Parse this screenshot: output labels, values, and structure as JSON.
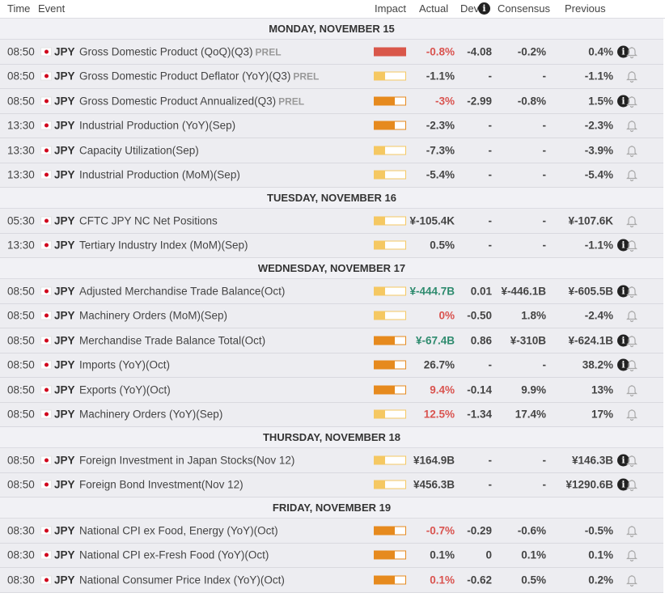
{
  "columns": {
    "time": "Time",
    "event": "Event",
    "impact": "Impact",
    "actual": "Actual",
    "dev": "Dev",
    "consensus": "Consensus",
    "previous": "Previous"
  },
  "colors": {
    "high": "#d9574a",
    "medium": "#e68a1e",
    "low": "#f5c862",
    "positive": "#2e8b6e",
    "negative": "#d9534f",
    "neutral": "#444444"
  },
  "days": [
    {
      "label": "MONDAY, NOVEMBER 15",
      "events": [
        {
          "time": "08:50",
          "currency": "JPY",
          "event": "Gross Domestic Product (QoQ)(Q3)",
          "tag": "PREL",
          "impact": "high",
          "actual": "-0.8%",
          "actual_tone": "negative",
          "dev": "-4.08",
          "consensus": "-0.2%",
          "previous": "0.4%",
          "info": true
        },
        {
          "time": "08:50",
          "currency": "JPY",
          "event": "Gross Domestic Product Deflator (YoY)(Q3)",
          "tag": "PREL",
          "impact": "low",
          "actual": "-1.1%",
          "actual_tone": "neutral",
          "dev": "-",
          "consensus": "-",
          "previous": "-1.1%",
          "info": false
        },
        {
          "time": "08:50",
          "currency": "JPY",
          "event": "Gross Domestic Product Annualized(Q3)",
          "tag": "PREL",
          "impact": "medium",
          "actual": "-3%",
          "actual_tone": "negative",
          "dev": "-2.99",
          "consensus": "-0.8%",
          "previous": "1.5%",
          "info": true
        },
        {
          "time": "13:30",
          "currency": "JPY",
          "event": "Industrial Production (YoY)(Sep)",
          "tag": "",
          "impact": "medium",
          "actual": "-2.3%",
          "actual_tone": "neutral",
          "dev": "-",
          "consensus": "-",
          "previous": "-2.3%",
          "info": false
        },
        {
          "time": "13:30",
          "currency": "JPY",
          "event": "Capacity Utilization(Sep)",
          "tag": "",
          "impact": "low",
          "actual": "-7.3%",
          "actual_tone": "neutral",
          "dev": "-",
          "consensus": "-",
          "previous": "-3.9%",
          "info": false
        },
        {
          "time": "13:30",
          "currency": "JPY",
          "event": "Industrial Production (MoM)(Sep)",
          "tag": "",
          "impact": "low",
          "actual": "-5.4%",
          "actual_tone": "neutral",
          "dev": "-",
          "consensus": "-",
          "previous": "-5.4%",
          "info": false
        }
      ]
    },
    {
      "label": "TUESDAY, NOVEMBER 16",
      "events": [
        {
          "time": "05:30",
          "currency": "JPY",
          "event": "CFTC JPY NC Net Positions",
          "tag": "",
          "impact": "low",
          "actual": "¥-105.4K",
          "actual_tone": "neutral",
          "dev": "-",
          "consensus": "-",
          "previous": "¥-107.6K",
          "info": false
        },
        {
          "time": "13:30",
          "currency": "JPY",
          "event": "Tertiary Industry Index (MoM)(Sep)",
          "tag": "",
          "impact": "low",
          "actual": "0.5%",
          "actual_tone": "neutral",
          "dev": "-",
          "consensus": "-",
          "previous": "-1.1%",
          "info": true
        }
      ]
    },
    {
      "label": "WEDNESDAY, NOVEMBER 17",
      "events": [
        {
          "time": "08:50",
          "currency": "JPY",
          "event": "Adjusted Merchandise Trade Balance(Oct)",
          "tag": "",
          "impact": "low",
          "actual": "¥-444.7B",
          "actual_tone": "positive",
          "dev": "0.01",
          "consensus": "¥-446.1B",
          "previous": "¥-605.5B",
          "info": true
        },
        {
          "time": "08:50",
          "currency": "JPY",
          "event": "Machinery Orders (MoM)(Sep)",
          "tag": "",
          "impact": "low",
          "actual": "0%",
          "actual_tone": "negative",
          "dev": "-0.50",
          "consensus": "1.8%",
          "previous": "-2.4%",
          "info": false
        },
        {
          "time": "08:50",
          "currency": "JPY",
          "event": "Merchandise Trade Balance Total(Oct)",
          "tag": "",
          "impact": "medium",
          "actual": "¥-67.4B",
          "actual_tone": "positive",
          "dev": "0.86",
          "consensus": "¥-310B",
          "previous": "¥-624.1B",
          "info": true
        },
        {
          "time": "08:50",
          "currency": "JPY",
          "event": "Imports (YoY)(Oct)",
          "tag": "",
          "impact": "medium",
          "actual": "26.7%",
          "actual_tone": "neutral",
          "dev": "-",
          "consensus": "-",
          "previous": "38.2%",
          "info": true
        },
        {
          "time": "08:50",
          "currency": "JPY",
          "event": "Exports (YoY)(Oct)",
          "tag": "",
          "impact": "medium",
          "actual": "9.4%",
          "actual_tone": "negative",
          "dev": "-0.14",
          "consensus": "9.9%",
          "previous": "13%",
          "info": false
        },
        {
          "time": "08:50",
          "currency": "JPY",
          "event": "Machinery Orders (YoY)(Sep)",
          "tag": "",
          "impact": "low",
          "actual": "12.5%",
          "actual_tone": "negative",
          "dev": "-1.34",
          "consensus": "17.4%",
          "previous": "17%",
          "info": false
        }
      ]
    },
    {
      "label": "THURSDAY, NOVEMBER 18",
      "events": [
        {
          "time": "08:50",
          "currency": "JPY",
          "event": "Foreign Investment in Japan Stocks(Nov 12)",
          "tag": "",
          "impact": "low",
          "actual": "¥164.9B",
          "actual_tone": "neutral",
          "dev": "-",
          "consensus": "-",
          "previous": "¥146.3B",
          "info": true
        },
        {
          "time": "08:50",
          "currency": "JPY",
          "event": "Foreign Bond Investment(Nov 12)",
          "tag": "",
          "impact": "low",
          "actual": "¥456.3B",
          "actual_tone": "neutral",
          "dev": "-",
          "consensus": "-",
          "previous": "¥1290.6B",
          "info": true
        }
      ]
    },
    {
      "label": "FRIDAY, NOVEMBER 19",
      "events": [
        {
          "time": "08:30",
          "currency": "JPY",
          "event": "National CPI ex Food, Energy (YoY)(Oct)",
          "tag": "",
          "impact": "medium",
          "actual": "-0.7%",
          "actual_tone": "negative",
          "dev": "-0.29",
          "consensus": "-0.6%",
          "previous": "-0.5%",
          "info": false
        },
        {
          "time": "08:30",
          "currency": "JPY",
          "event": "National CPI ex-Fresh Food (YoY)(Oct)",
          "tag": "",
          "impact": "medium",
          "actual": "0.1%",
          "actual_tone": "neutral",
          "dev": "0",
          "consensus": "0.1%",
          "previous": "0.1%",
          "info": false
        },
        {
          "time": "08:30",
          "currency": "JPY",
          "event": "National Consumer Price Index (YoY)(Oct)",
          "tag": "",
          "impact": "medium",
          "actual": "0.1%",
          "actual_tone": "negative",
          "dev": "-0.62",
          "consensus": "0.5%",
          "previous": "0.2%",
          "info": false
        }
      ]
    }
  ]
}
